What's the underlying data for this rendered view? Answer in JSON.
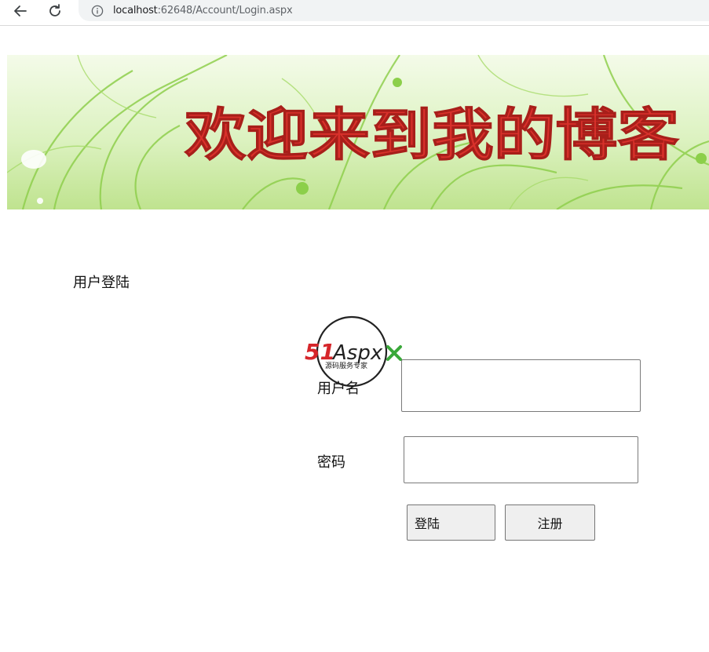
{
  "browser": {
    "url_host": "localhost",
    "url_rest": ":62648/Account/Login.aspx"
  },
  "banner": {
    "headline": "欢迎来到我的博客"
  },
  "login": {
    "title": "用户登陆",
    "username_label": "用户名",
    "password_label": "密码",
    "username_value": "",
    "password_value": "",
    "login_button": "登陆",
    "register_button": "注册"
  },
  "watermark": {
    "brand_51": "51",
    "brand_aspx": "Aspx",
    "tagline": "源码服务专家"
  },
  "colors": {
    "banner_text": "#d9312b",
    "banner_green": "#c9eaa0",
    "watermark_red": "#d6262b",
    "watermark_green": "#3aa83a"
  }
}
